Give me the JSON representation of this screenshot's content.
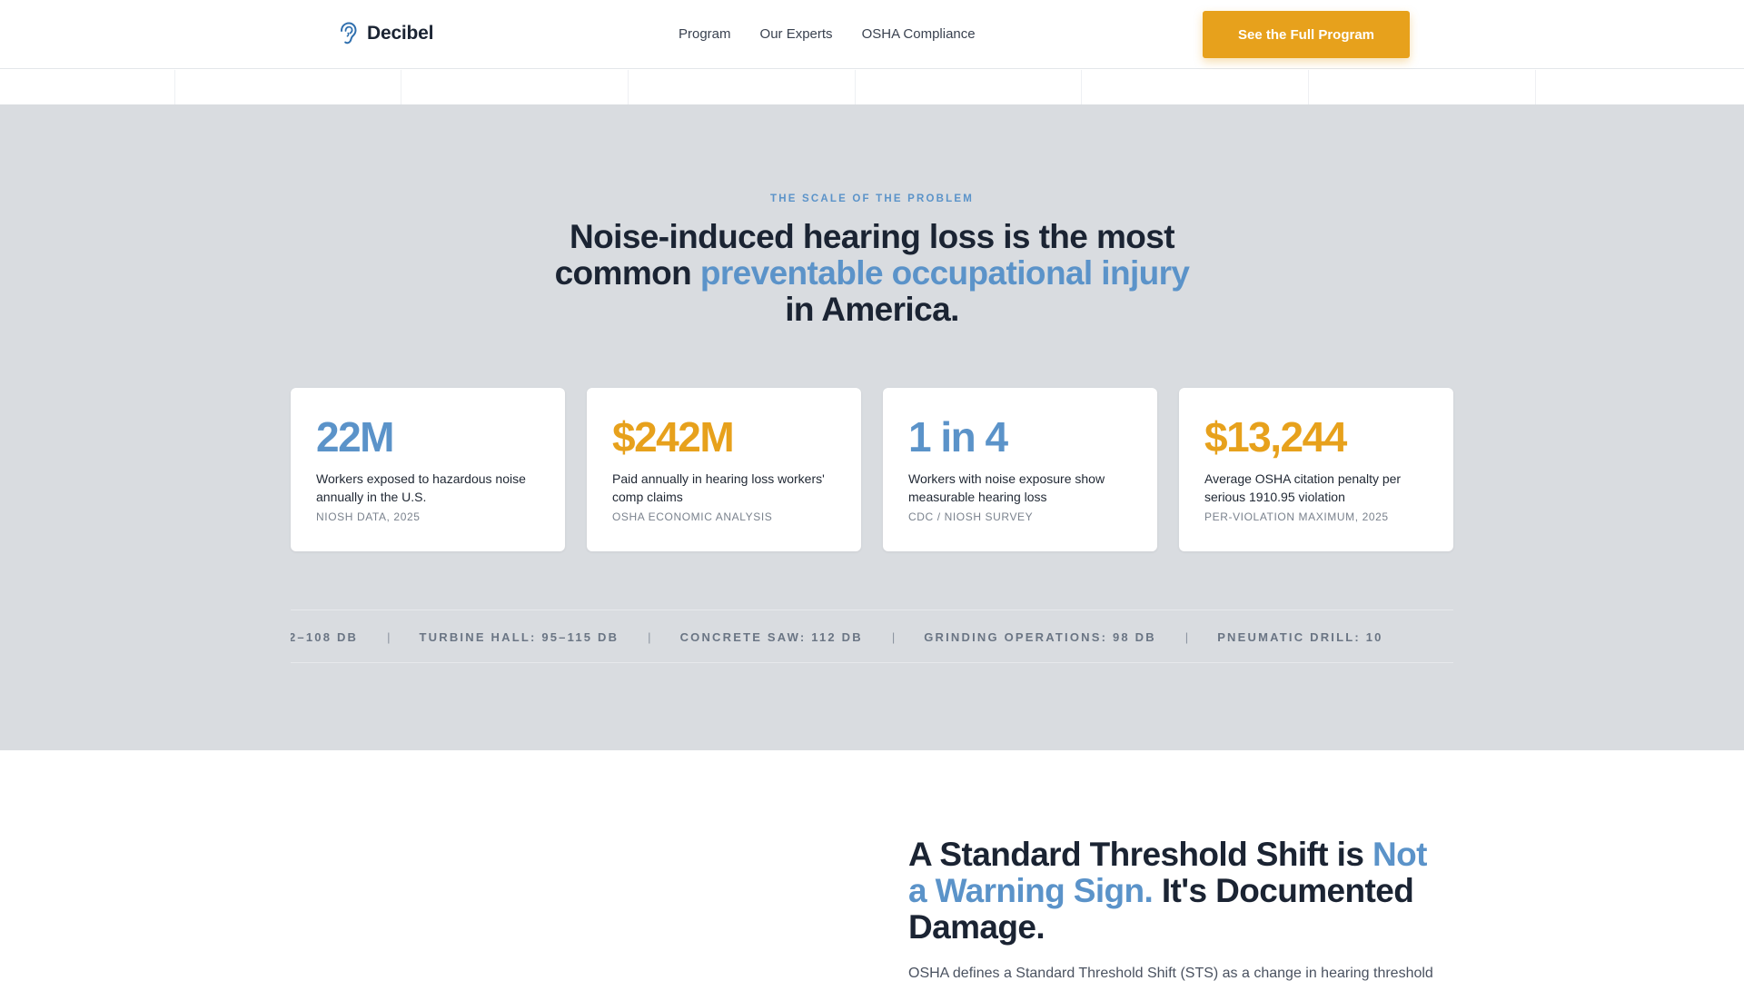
{
  "header": {
    "logo_icon": "ear-icon",
    "brand": "Decibel",
    "nav": [
      {
        "label": "Program"
      },
      {
        "label": "Our Experts"
      },
      {
        "label": "OSHA Compliance"
      }
    ],
    "cta_label": "See the Full Program"
  },
  "problem": {
    "eyebrow": "THE SCALE OF THE PROBLEM",
    "headline": {
      "part1": "Noise-induced hearing loss is the most common ",
      "accent": "preventable occupational injury",
      "part2": " in America."
    },
    "stats": [
      {
        "value": "22M",
        "desc": "Workers exposed to hazardous noise annually in the U.S.",
        "source": "NIOSH DATA, 2025",
        "color": "#5b93c9"
      },
      {
        "value": "$242M",
        "desc": "Paid annually in hearing loss workers' comp claims",
        "source": "OSHA ECONOMIC ANALYSIS",
        "color": "#e7a11c"
      },
      {
        "value": "1 in 4",
        "desc": "Workers with noise exposure show measurable hearing loss",
        "source": "CDC / NIOSH SURVEY",
        "color": "#5b93c9"
      },
      {
        "value": "$13,244",
        "desc": "Average OSHA citation penalty per serious 1910.95 violation",
        "source": "PER-VIOLATION MAXIMUM, 2025",
        "color": "#e7a11c"
      }
    ],
    "ticker": [
      "2–108 DB",
      "TURBINE HALL: 95–115 DB",
      "CONCRETE SAW: 112 DB",
      "GRINDING OPERATIONS: 98 DB",
      "PNEUMATIC DRILL: 10"
    ],
    "ticker_separator": "|"
  },
  "sts": {
    "title": {
      "part1": "A Standard Threshold Shift is ",
      "accent": "Not a Warning Sign.",
      "part2": " It's Documented Damage."
    },
    "body": "OSHA defines a Standard Threshold Shift (STS) as a change in hearing threshold"
  },
  "colors": {
    "accent_blue": "#5b93c9",
    "accent_gold": "#e7a11c",
    "section_bg": "#d9dce0"
  }
}
